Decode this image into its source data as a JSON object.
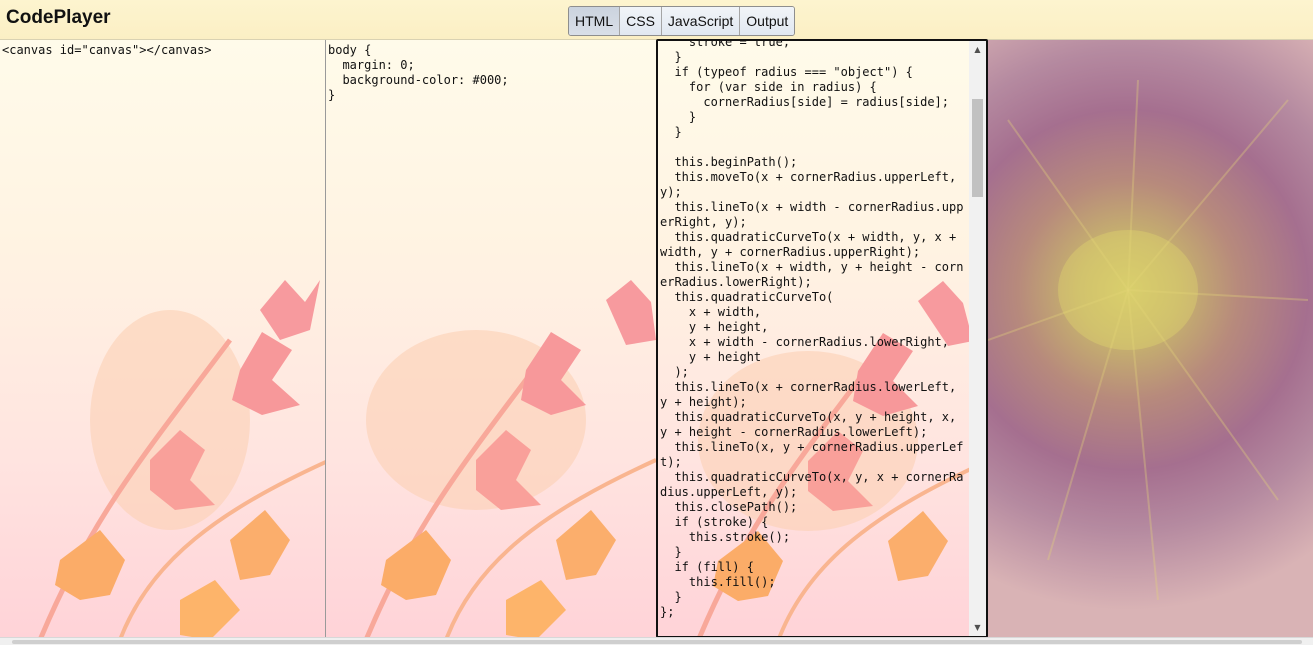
{
  "app": {
    "title": "CodePlayer"
  },
  "toggles": [
    {
      "label": "HTML",
      "active": true
    },
    {
      "label": "CSS",
      "active": false
    },
    {
      "label": "JavaScript",
      "active": false
    },
    {
      "label": "Output",
      "active": false
    }
  ],
  "html_code": "<canvas id=\"canvas\"></canvas>",
  "css_code": "body {\n  margin: 0;\n  background-color: #000;\n}",
  "js_code": "    stroke = true;\n  }\n  if (typeof radius === \"object\") {\n    for (var side in radius) {\n      cornerRadius[side] = radius[side];\n    }\n  }\n\n  this.beginPath();\n  this.moveTo(x + cornerRadius.upperLeft, y);\n  this.lineTo(x + width - cornerRadius.upperRight, y);\n  this.quadraticCurveTo(x + width, y, x + width, y + cornerRadius.upperRight);\n  this.lineTo(x + width, y + height - cornerRadius.lowerRight);\n  this.quadraticCurveTo(\n    x + width,\n    y + height,\n    x + width - cornerRadius.lowerRight,\n    y + height\n  );\n  this.lineTo(x + cornerRadius.lowerLeft, y + height);\n  this.quadraticCurveTo(x, y + height, x, y + height - cornerRadius.lowerLeft);\n  this.lineTo(x, y + cornerRadius.upperLeft);\n  this.quadraticCurveTo(x, y, x + cornerRadius.upperLeft, y);\n  this.closePath();\n  if (stroke) {\n    this.stroke();\n  }\n  if (fill) {\n    this.fill();\n  }\n};",
  "scrollbar": {
    "up_icon": "triangle-up",
    "down_icon": "triangle-down"
  },
  "colors": {
    "header": "#fbefc4",
    "leaf_pink": "#f79a9e",
    "leaf_orange": "#fbac68"
  }
}
